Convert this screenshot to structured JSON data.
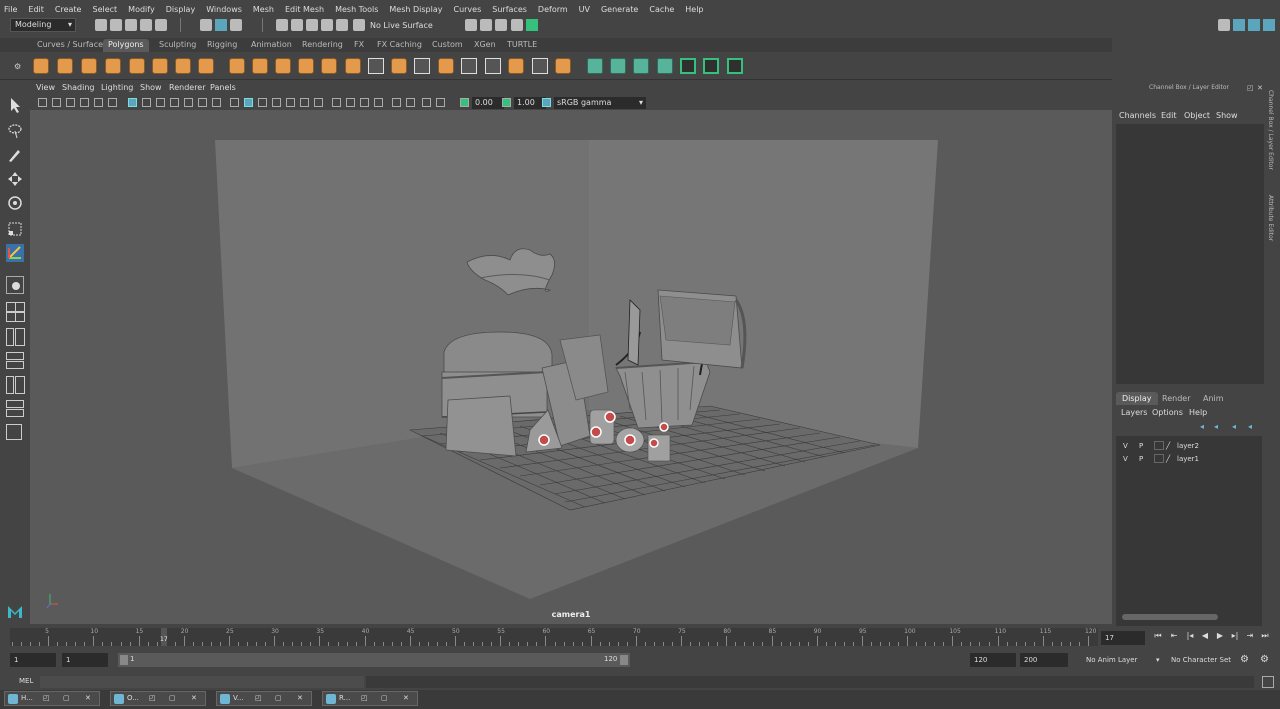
{
  "menubar": [
    "File",
    "Edit",
    "Create",
    "Select",
    "Modify",
    "Display",
    "Windows",
    "Mesh",
    "Edit Mesh",
    "Mesh Tools",
    "Mesh Display",
    "Curves",
    "Surfaces",
    "Deform",
    "UV",
    "Generate",
    "Cache",
    "Help"
  ],
  "status": {
    "workspace": "Modeling",
    "live_surface": "No Live Surface"
  },
  "shelf_tabs": [
    {
      "label": "Curves / Surfaces",
      "active": false
    },
    {
      "label": "Polygons",
      "active": true
    },
    {
      "label": "Sculpting",
      "active": false
    },
    {
      "label": "Rigging",
      "active": false
    },
    {
      "label": "Animation",
      "active": false
    },
    {
      "label": "Rendering",
      "active": false
    },
    {
      "label": "FX",
      "active": false
    },
    {
      "label": "FX Caching",
      "active": false
    },
    {
      "label": "Custom",
      "active": false
    },
    {
      "label": "XGen",
      "active": false
    },
    {
      "label": "TURTLE",
      "active": false
    }
  ],
  "viewport": {
    "menu": [
      "View",
      "Shading",
      "Lighting",
      "Show",
      "Renderer",
      "Panels"
    ],
    "exposure": "0.00",
    "gamma": "1.00",
    "color_space": "sRGB gamma",
    "camera_label": "camera1"
  },
  "right_panel": {
    "title": "Channel Box / Layer Editor",
    "channel_menu": [
      "Channels",
      "Edit",
      "Object",
      "Show"
    ],
    "layer_tabs": [
      {
        "label": "Display",
        "active": true
      },
      {
        "label": "Render",
        "active": false
      },
      {
        "label": "Anim",
        "active": false
      }
    ],
    "layer_menu": [
      "Layers",
      "Options",
      "Help"
    ],
    "layers": [
      {
        "v": "V",
        "p": "P",
        "name": "layer2"
      },
      {
        "v": "V",
        "p": "P",
        "name": "layer1"
      }
    ],
    "side_tabs": [
      "Channel Box / Layer Editor",
      "Attribute Editor"
    ]
  },
  "timeline": {
    "ticks": [
      5,
      10,
      15,
      20,
      25,
      30,
      35,
      40,
      45,
      50,
      55,
      60,
      65,
      70,
      75,
      80,
      85,
      90,
      95,
      100,
      105,
      110,
      115,
      120
    ],
    "current_marker": "17",
    "current_frame": "17"
  },
  "range": {
    "start": "1",
    "playback_start": "1",
    "slider_start": "1",
    "slider_end": "120",
    "playback_end": "120",
    "end": "200",
    "anim_layer": "No Anim Layer",
    "char_set": "No Character Set"
  },
  "cmdline": {
    "lang": "MEL"
  },
  "taskbar": [
    "H...",
    "O...",
    "V...",
    "R..."
  ]
}
